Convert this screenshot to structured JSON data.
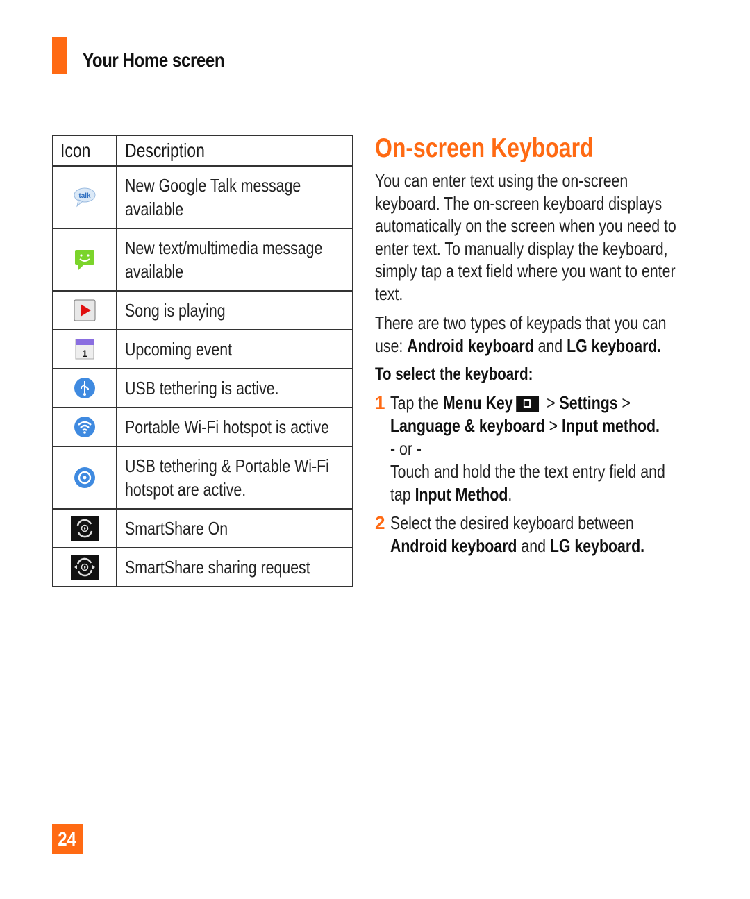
{
  "header": {
    "title": "Your Home screen",
    "accent_color": "#ff6a13"
  },
  "table": {
    "headers": [
      "Icon",
      "Description"
    ],
    "rows": [
      {
        "icon": "google-talk-icon",
        "description": "New Google Talk message available"
      },
      {
        "icon": "text-message-icon",
        "description": "New text/multimedia message available"
      },
      {
        "icon": "song-playing-icon",
        "description": "Song is playing"
      },
      {
        "icon": "calendar-event-icon",
        "description": "Upcoming event"
      },
      {
        "icon": "usb-tethering-icon",
        "description": "USB tethering is active."
      },
      {
        "icon": "wifi-hotspot-icon",
        "description": "Portable Wi-Fi hotspot is active"
      },
      {
        "icon": "usb-wifi-tethering-icon",
        "description": "USB tethering & Portable Wi-Fi hotspot are active."
      },
      {
        "icon": "smartshare-on-icon",
        "description": "SmartShare On"
      },
      {
        "icon": "smartshare-request-icon",
        "description": "SmartShare sharing request"
      }
    ]
  },
  "section": {
    "title": "On-screen Keyboard",
    "intro": "You can enter text using the on-screen keyboard. The on-screen keyboard displays automatically on the screen when you need to enter text. To manually display the keyboard, simply tap a text field where you want to enter text.",
    "types_prefix": "There are two types of keypads that you can use: ",
    "android_keyboard": "Android keyboard",
    "and": " and ",
    "lg_keyboard": "LG keyboard.",
    "subheading": "To select the keyboard:",
    "steps": [
      {
        "num": "1",
        "tap_the": "Tap the ",
        "menu_key": "Menu Key",
        "sep": " > ",
        "settings": "Settings",
        "language": "Language & keyboard",
        "input_method": "Input method.",
        "or": "- or -",
        "touch_hold": "Touch and hold the the text entry field and tap ",
        "input_method2": "Input Method",
        "period": "."
      },
      {
        "num": "2",
        "text": "Select the desired keyboard between ",
        "android_keyboard": "Android keyboard",
        "and": " and ",
        "lg_keyboard": "LG keyboard."
      }
    ]
  },
  "page_number": "24"
}
